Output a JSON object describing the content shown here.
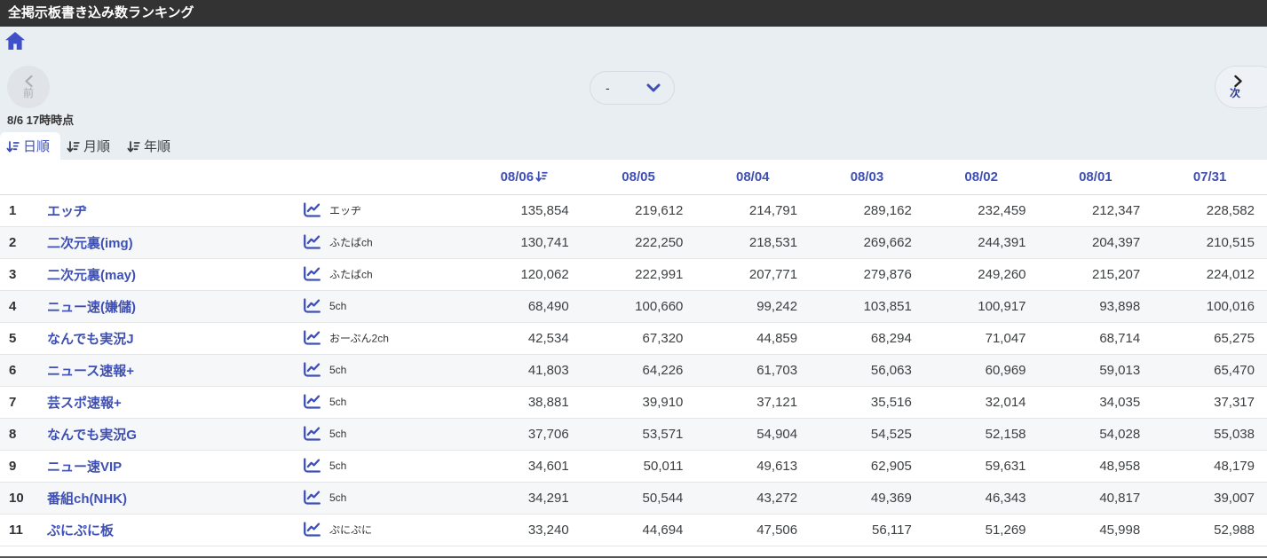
{
  "header": {
    "title": "全掲示板書き込み数ランキング"
  },
  "toolbar": {
    "prev_label": "前",
    "next_label": "次",
    "dropdown_value": "-",
    "timestamp": "8/6 17時時点"
  },
  "tabs": [
    {
      "label": "日順",
      "active": true
    },
    {
      "label": "月順",
      "active": false
    },
    {
      "label": "年順",
      "active": false
    }
  ],
  "icons": {
    "home": "home-icon",
    "sort": "sort-descending-icon",
    "chart": "line-chart-icon",
    "chevron_left": "chevron-left-icon",
    "chevron_right": "chevron-right-icon",
    "chevron_down": "chevron-down-icon"
  },
  "colors": {
    "accent": "#3e50b4",
    "titlebar_bg": "#333333",
    "page_bg": "#e9eef3",
    "row_alt_bg": "#f6f7f8"
  },
  "table": {
    "date_columns": [
      "08/06",
      "08/05",
      "08/04",
      "08/03",
      "08/02",
      "08/01",
      "07/31"
    ],
    "sorted_column": "08/06",
    "rows": [
      {
        "rank": "1",
        "name": "エッヂ",
        "source": "エッヂ",
        "values": [
          "135,854",
          "219,612",
          "214,791",
          "289,162",
          "232,459",
          "212,347",
          "228,582"
        ]
      },
      {
        "rank": "2",
        "name": "二次元裏(img)",
        "source": "ふたばch",
        "values": [
          "130,741",
          "222,250",
          "218,531",
          "269,662",
          "244,391",
          "204,397",
          "210,515"
        ]
      },
      {
        "rank": "3",
        "name": "二次元裏(may)",
        "source": "ふたばch",
        "values": [
          "120,062",
          "222,991",
          "207,771",
          "279,876",
          "249,260",
          "215,207",
          "224,012"
        ]
      },
      {
        "rank": "4",
        "name": "ニュー速(嫌儲)",
        "source": "5ch",
        "values": [
          "68,490",
          "100,660",
          "99,242",
          "103,851",
          "100,917",
          "93,898",
          "100,016"
        ]
      },
      {
        "rank": "5",
        "name": "なんでも実況J",
        "source": "おーぷん2ch",
        "values": [
          "42,534",
          "67,320",
          "44,859",
          "68,294",
          "71,047",
          "68,714",
          "65,275"
        ]
      },
      {
        "rank": "6",
        "name": "ニュース速報+",
        "source": "5ch",
        "values": [
          "41,803",
          "64,226",
          "61,703",
          "56,063",
          "60,969",
          "59,013",
          "65,470"
        ]
      },
      {
        "rank": "7",
        "name": "芸スポ速報+",
        "source": "5ch",
        "values": [
          "38,881",
          "39,910",
          "37,121",
          "35,516",
          "32,014",
          "34,035",
          "37,317"
        ]
      },
      {
        "rank": "8",
        "name": "なんでも実況G",
        "source": "5ch",
        "values": [
          "37,706",
          "53,571",
          "54,904",
          "54,525",
          "52,158",
          "54,028",
          "55,038"
        ]
      },
      {
        "rank": "9",
        "name": "ニュー速VIP",
        "source": "5ch",
        "values": [
          "34,601",
          "50,011",
          "49,613",
          "62,905",
          "59,631",
          "48,958",
          "48,179"
        ]
      },
      {
        "rank": "10",
        "name": "番組ch(NHK)",
        "source": "5ch",
        "values": [
          "34,291",
          "50,544",
          "43,272",
          "49,369",
          "46,343",
          "40,817",
          "39,007"
        ]
      },
      {
        "rank": "11",
        "name": "ぷにぷに板",
        "source": "ぷにぷに",
        "values": [
          "33,240",
          "44,694",
          "47,506",
          "56,117",
          "51,269",
          "45,998",
          "52,988"
        ]
      }
    ]
  }
}
